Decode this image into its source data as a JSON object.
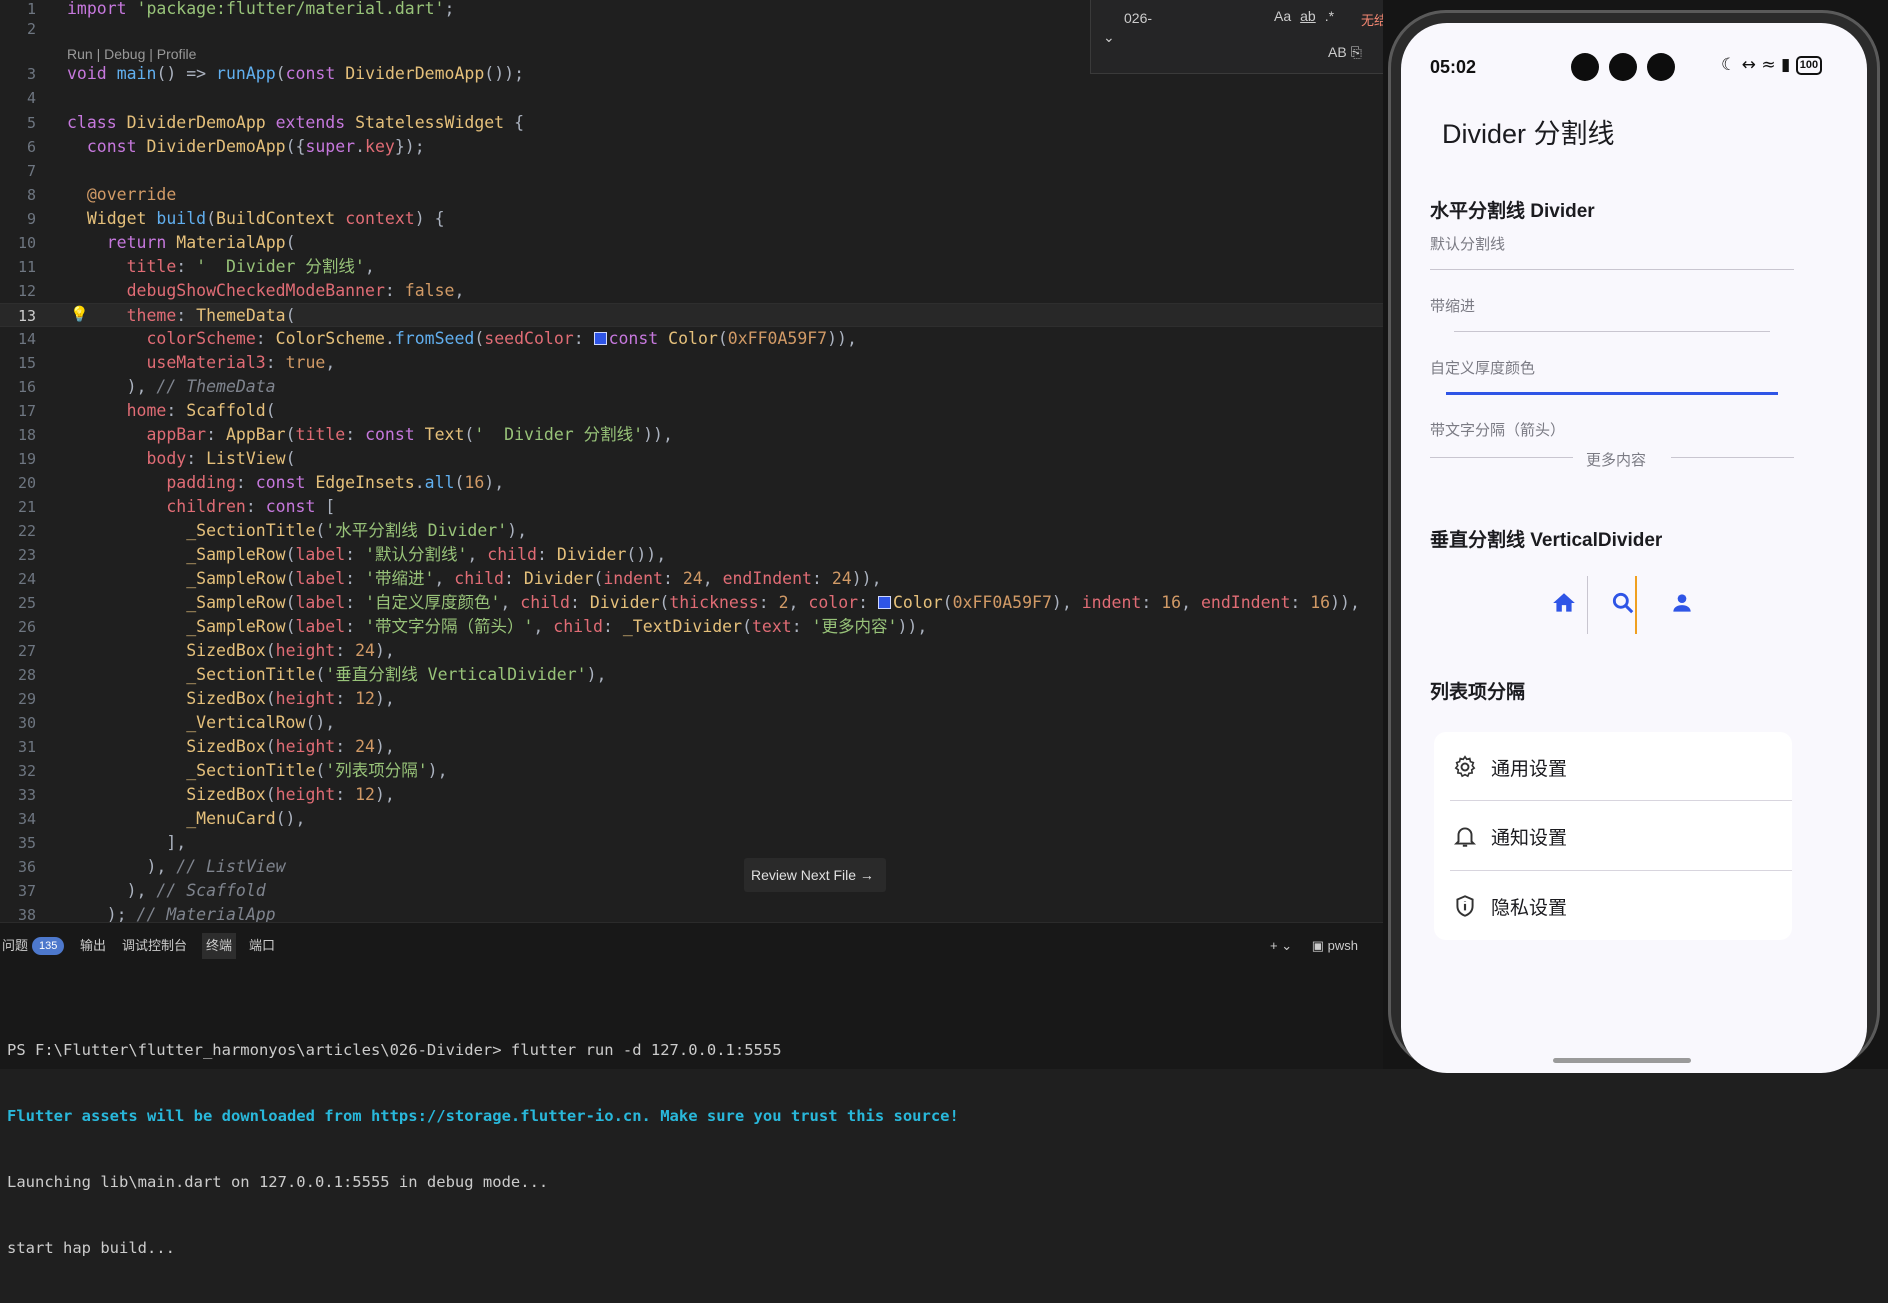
{
  "editor": {
    "codelens": "Run | Debug | Profile",
    "review_button": "Review Next File",
    "current_line": "13"
  },
  "find_widget": {
    "query": "026-",
    "options": [
      "Aa",
      "ab",
      ".*"
    ],
    "no_results": "无结果",
    "preserve_case": "AB"
  },
  "panel": {
    "tabs": [
      "问题",
      "输出",
      "调试控制台",
      "终端",
      "端口"
    ],
    "problems_count": "135",
    "active_tab": "终端",
    "shell": "pwsh",
    "terminal_lines": [
      "PS F:\\Flutter\\flutter_harmonyos\\articles\\026-Divider> flutter run -d 127.0.0.1:5555",
      "Flutter assets will be downloaded from https://storage.flutter-io.cn. Make sure you trust this source!",
      "Launching lib\\main.dart on 127.0.0.1:5555 in debug mode...",
      "start hap build..."
    ]
  },
  "phone": {
    "status_time": "05:02",
    "battery": "100",
    "app_title": "Divider 分割线",
    "section_horizontal": "水平分割线 Divider",
    "label_default": "默认分割线",
    "label_indent": "带缩进",
    "label_custom": "自定义厚度颜色",
    "label_text_divider": "带文字分隔（箭头）",
    "text_divider_text": "更多内容",
    "section_vertical": "垂直分割线 VerticalDivider",
    "section_list": "列表项分隔",
    "menu_items": [
      "通用设置",
      "通知设置",
      "隐私设置"
    ],
    "accent_color": "#2f55e6",
    "vertical_divider_color": "#f0a020"
  }
}
